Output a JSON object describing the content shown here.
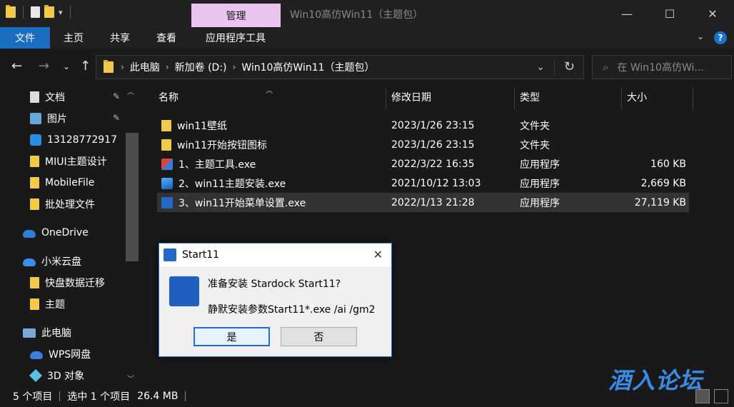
{
  "titlebar": {
    "manage_tab": "管理",
    "window_title": "Win10高仿Win11（主题包）",
    "minimize": "—",
    "maximize": "☐",
    "close": "✕"
  },
  "ribbon": {
    "tabs": [
      "文件",
      "主页",
      "共享",
      "查看",
      "应用程序工具"
    ],
    "collapse": "⌄",
    "help": "?"
  },
  "address": {
    "crumbs": [
      "此电脑",
      "新加卷 (D:)",
      "Win10高仿Win11（主题包）"
    ],
    "search_placeholder": "在 Win10高仿Wi..."
  },
  "sidebar": {
    "items": [
      {
        "label": "文档",
        "icon": "document-icon",
        "pinned": true
      },
      {
        "label": "图片",
        "icon": "picture-icon",
        "pinned": true
      },
      {
        "label": "13128772917",
        "icon": "sync-icon",
        "pinned": false
      },
      {
        "label": "MIUI主题设计",
        "icon": "folder-icon",
        "pinned": false
      },
      {
        "label": "MobileFile",
        "icon": "folder-icon",
        "pinned": false
      },
      {
        "label": "批处理文件",
        "icon": "folder-icon",
        "pinned": false
      },
      {
        "label": "OneDrive",
        "icon": "onedrive-icon",
        "pinned": false
      },
      {
        "label": "小米云盘",
        "icon": "mi-cloud-icon",
        "pinned": false
      },
      {
        "label": "快盘数据迁移",
        "icon": "folder-icon",
        "pinned": false
      },
      {
        "label": "主题",
        "icon": "folder-icon",
        "pinned": false
      },
      {
        "label": "此电脑",
        "icon": "computer-icon",
        "pinned": false
      },
      {
        "label": "WPS网盘",
        "icon": "wps-cloud-icon",
        "pinned": false
      },
      {
        "label": "3D 对象",
        "icon": "3d-objects-icon",
        "pinned": false
      }
    ]
  },
  "table": {
    "columns": [
      "名称",
      "修改日期",
      "类型",
      "大小"
    ],
    "rows": [
      {
        "name": "win11壁纸",
        "date": "2023/1/26 23:15",
        "type": "文件夹",
        "size": "",
        "icon": "folder-icon"
      },
      {
        "name": "win11开始按钮图标",
        "date": "2023/1/26 23:15",
        "type": "文件夹",
        "size": "",
        "icon": "folder-icon"
      },
      {
        "name": "1、主题工具.exe",
        "date": "2022/3/22 16:35",
        "type": "应用程序",
        "size": "160 KB",
        "icon": "theme-tool-app-icon"
      },
      {
        "name": "2、win11主题安装.exe",
        "date": "2021/10/12 13:03",
        "type": "应用程序",
        "size": "2,669 KB",
        "icon": "installer-app-icon"
      },
      {
        "name": "3、win11开始菜单设置.exe",
        "date": "2022/1/13 21:28",
        "type": "应用程序",
        "size": "27,119 KB",
        "icon": "start11-app-icon"
      }
    ],
    "selected_index": 4
  },
  "dialog": {
    "title": "Start11",
    "line1": "准备安装 Stardock Start11?",
    "line2": "静默安装参数Start11*.exe /ai /gm2",
    "yes": "是",
    "no": "否",
    "close": "✕"
  },
  "status": {
    "count": "5 个项目",
    "selected": "选中 1 个项目",
    "size": "26.4 MB"
  },
  "watermark": "酒入论坛",
  "colors": {
    "accent": "#1a6dbf",
    "manage_tab": "#e8c4ef",
    "folder": "#f2c94c",
    "background": "#191919"
  }
}
